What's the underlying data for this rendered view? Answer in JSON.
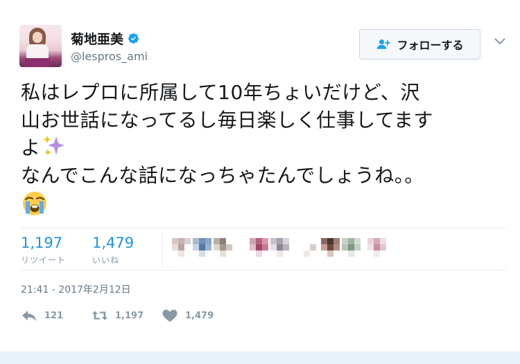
{
  "user": {
    "display_name": "菊地亜美",
    "handle": "@lespros_ami",
    "verified": true
  },
  "follow_button": {
    "label": "フォローする",
    "icon": "follow-person-icon"
  },
  "tweet": {
    "lines": [
      "私はレプロに所属して10年ちょいだけど、沢",
      "山お世話になってるし毎日楽しく仕事してます",
      "よ",
      "なんでこんな話になっちゃたんでしょうね。。"
    ],
    "emoji_after_line3": "sparkles",
    "emoji_line5": "loudly-crying-face"
  },
  "stats": {
    "retweets_count": "1,197",
    "retweets_label": "リツイート",
    "likes_count": "1,479",
    "likes_label": "いいね"
  },
  "timestamp": "21:41 - 2017年2月12日",
  "actions": {
    "reply_count": "121",
    "retweet_count": "1,197",
    "like_count": "1,479"
  },
  "colors": {
    "link_blue": "#1b95e0",
    "verified_blue": "#1da1f2",
    "muted": "#657786",
    "icon_gray": "#8899a6"
  }
}
